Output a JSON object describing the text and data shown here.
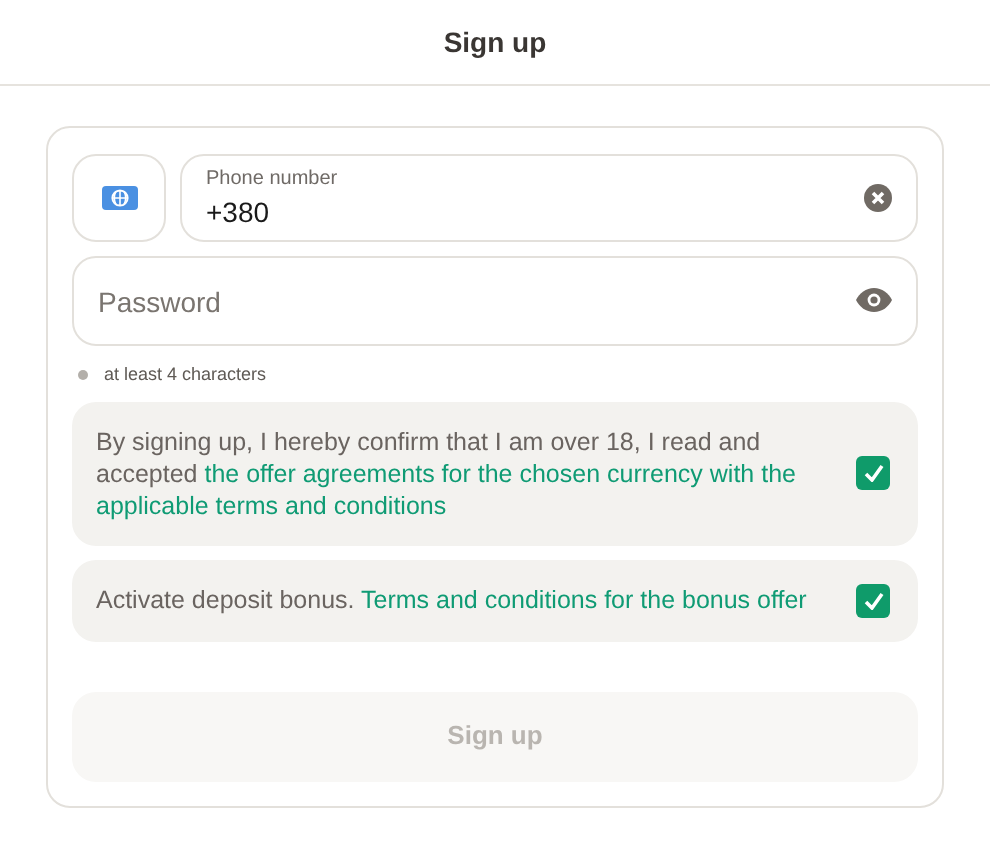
{
  "header": {
    "title": "Sign up"
  },
  "phone": {
    "label": "Phone number",
    "value": "+380"
  },
  "password": {
    "placeholder": "Password"
  },
  "hint": "at least 4 characters",
  "consents": [
    {
      "text": "By signing up, I hereby confirm that I am over 18, I read and accepted",
      "link": "the offer agreements for the chosen currency with the applicable terms and conditions",
      "checked": true
    },
    {
      "text": "Activate deposit bonus.",
      "link": "Terms and conditions for the bonus offer",
      "checked": true
    }
  ],
  "submit": {
    "label": "Sign up",
    "disabled": true
  }
}
